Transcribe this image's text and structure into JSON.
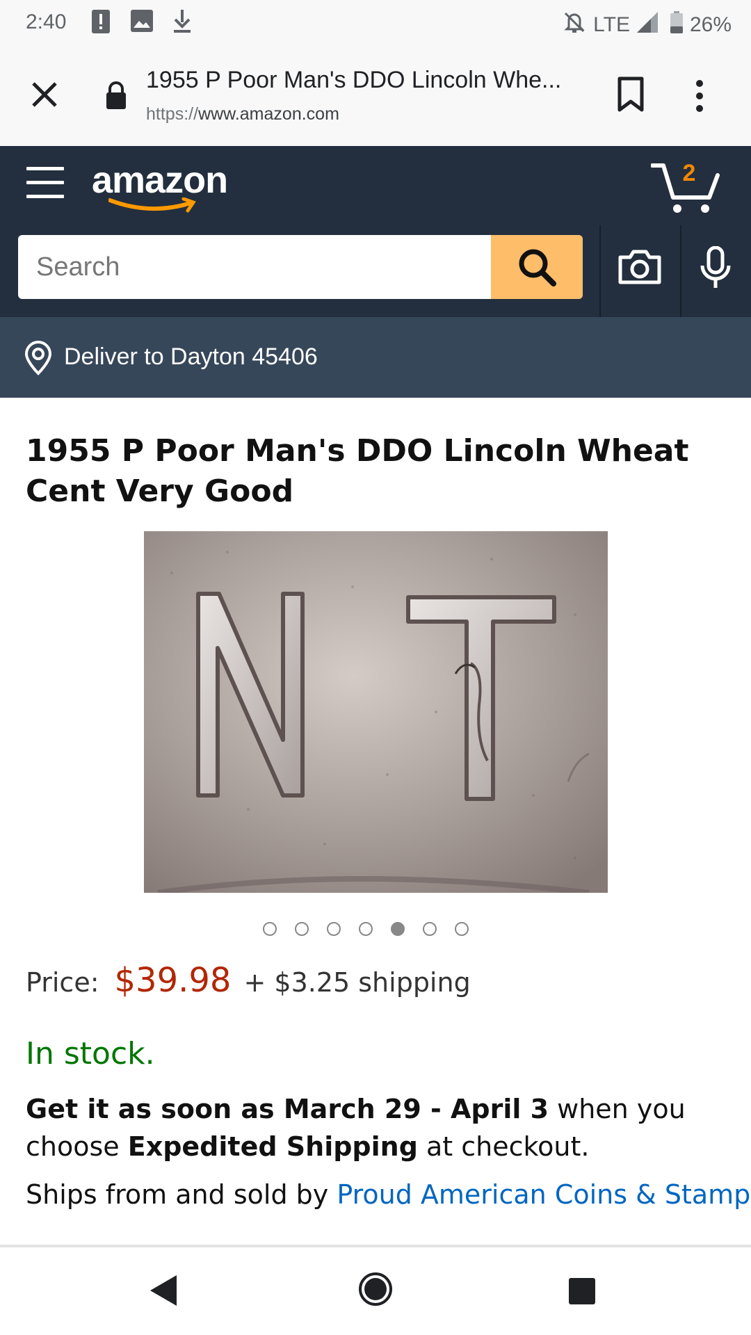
{
  "status_bar": {
    "time": "2:40",
    "network": "LTE",
    "battery": "26%",
    "icons": [
      "alert-icon",
      "image-icon",
      "download-icon",
      "mute-icon",
      "signal-icon",
      "battery-icon"
    ]
  },
  "browser": {
    "page_title": "1955 P Poor Man's DDO Lincoln Whe...",
    "url_scheme": "https://",
    "url_host": "www.amazon.com"
  },
  "amazon_header": {
    "logo_text": "amazon",
    "cart_count": "2"
  },
  "search": {
    "placeholder": "Search",
    "value": ""
  },
  "deliver": {
    "text": "Deliver to Dayton 45406"
  },
  "product": {
    "title": "1955 P Poor Man's DDO Lincoln Wheat Cent Very Good",
    "image_letters": "NT",
    "carousel": {
      "total": 7,
      "active_index": 4
    },
    "price_label": "Price:",
    "price": "$39.98",
    "shipping": "+ $3.25 shipping",
    "stock": "In stock.",
    "delivery": {
      "part1": "Get it as soon as March 29 - April 3",
      "part2": " when you choose ",
      "part3": "Expedited Shipping",
      "part4": " at checkout."
    },
    "seller": {
      "prefix": "Ships from and sold by ",
      "name": "Proud American Coins & Stamps",
      "suffix": "."
    }
  },
  "colors": {
    "amazon_dark": "#232f3e",
    "deliver_bar": "#37475a",
    "search_button": "#febd69",
    "price": "#b12704",
    "stock": "#007600",
    "link": "#0066c0",
    "cart_badge": "#f08804"
  }
}
